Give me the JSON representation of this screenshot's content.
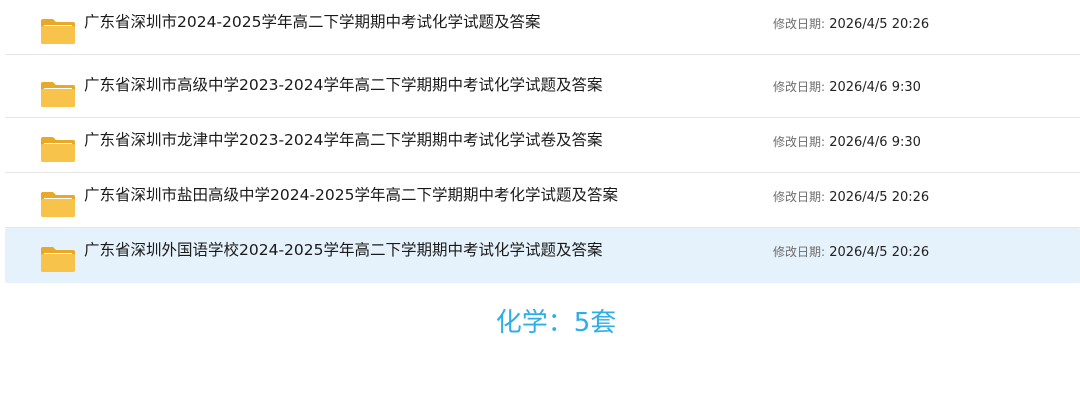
{
  "files": [
    {
      "name": "广东省深圳市2024-2025学年高二下学期期中考试化学试题及答案",
      "date_label": "修改日期:",
      "date": "2026/4/5 20:26"
    },
    {
      "name": "广东省深圳市高级中学2023-2024学年高二下学期期中考试化学试题及答案",
      "date_label": "修改日期:",
      "date": "2026/4/6 9:30"
    },
    {
      "name": "广东省深圳市龙津中学2023-2024学年高二下学期期中考试化学试卷及答案",
      "date_label": "修改日期:",
      "date": "2026/4/6 9:30"
    },
    {
      "name": "广东省深圳市盐田高级中学2024-2025学年高二下学期期中考化学试题及答案",
      "date_label": "修改日期:",
      "date": "2026/4/5 20:26"
    },
    {
      "name": "广东省深圳外国语学校2024-2025学年高二下学期期中考试化学试题及答案",
      "date_label": "修改日期:",
      "date": "2026/4/5 20:26"
    }
  ],
  "selected_index": 4,
  "summary": "化学：5套",
  "colors": {
    "selected_bg": "#e5f1fb",
    "summary_text": "#2eaee8",
    "folder_body": "#f8c34a",
    "folder_back": "#e9a825"
  },
  "icons": {
    "file_icon": "folder-icon"
  }
}
